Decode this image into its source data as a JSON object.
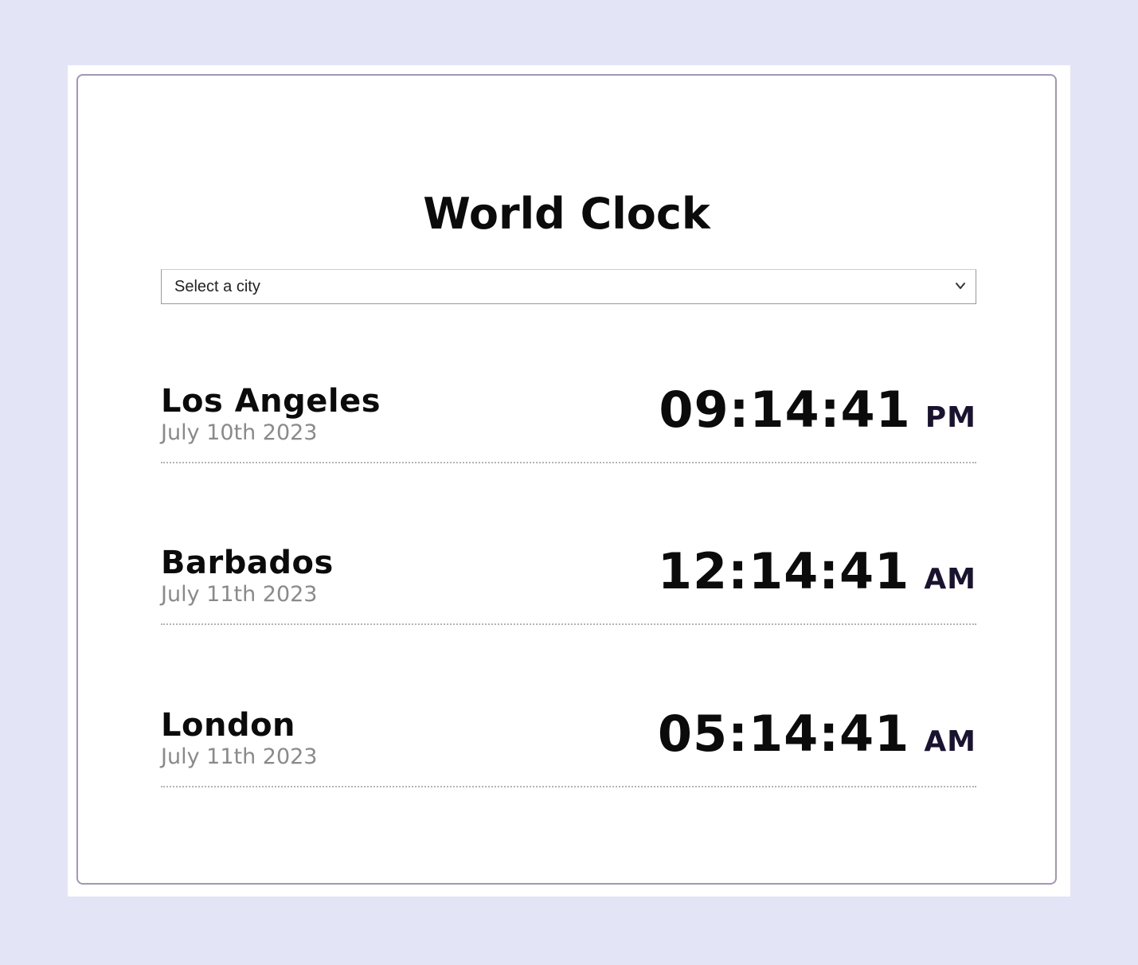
{
  "page": {
    "title": "World Clock",
    "background": "#e4e4f7",
    "card_border": "#a297b4"
  },
  "city_select": {
    "placeholder": "Select a city",
    "icon": "chevron-down-icon"
  },
  "clocks": [
    {
      "city": "Los Angeles",
      "date": "July 10th 2023",
      "time": "09:14:41",
      "period": "PM"
    },
    {
      "city": "Barbados",
      "date": "July 11th 2023",
      "time": "12:14:41",
      "period": "AM"
    },
    {
      "city": "London",
      "date": "July 11th 2023",
      "time": "05:14:41",
      "period": "AM"
    }
  ]
}
